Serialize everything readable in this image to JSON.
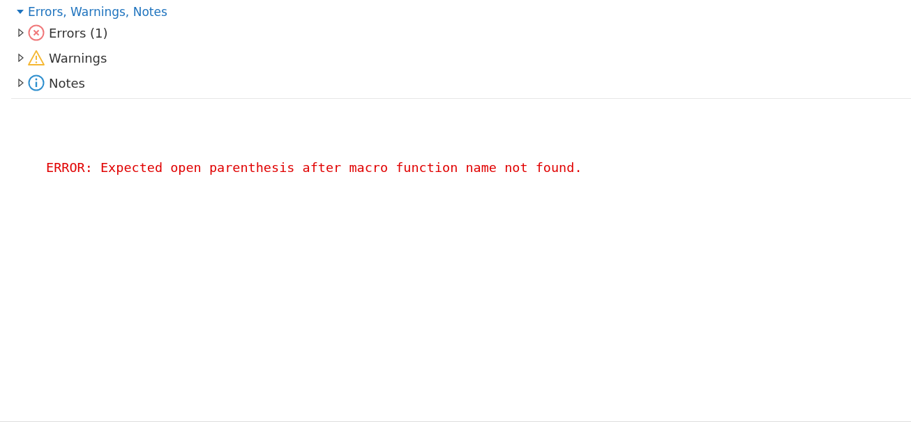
{
  "section": {
    "title": "Errors, Warnings, Notes",
    "expanded": true,
    "items": [
      {
        "kind": "error",
        "label": "Errors (1)",
        "expanded": false
      },
      {
        "kind": "warning",
        "label": "Warnings",
        "expanded": false
      },
      {
        "kind": "note",
        "label": "Notes",
        "expanded": false
      }
    ]
  },
  "log": {
    "lines": [
      "ERROR: Expected open parenthesis after macro function name not found."
    ]
  }
}
